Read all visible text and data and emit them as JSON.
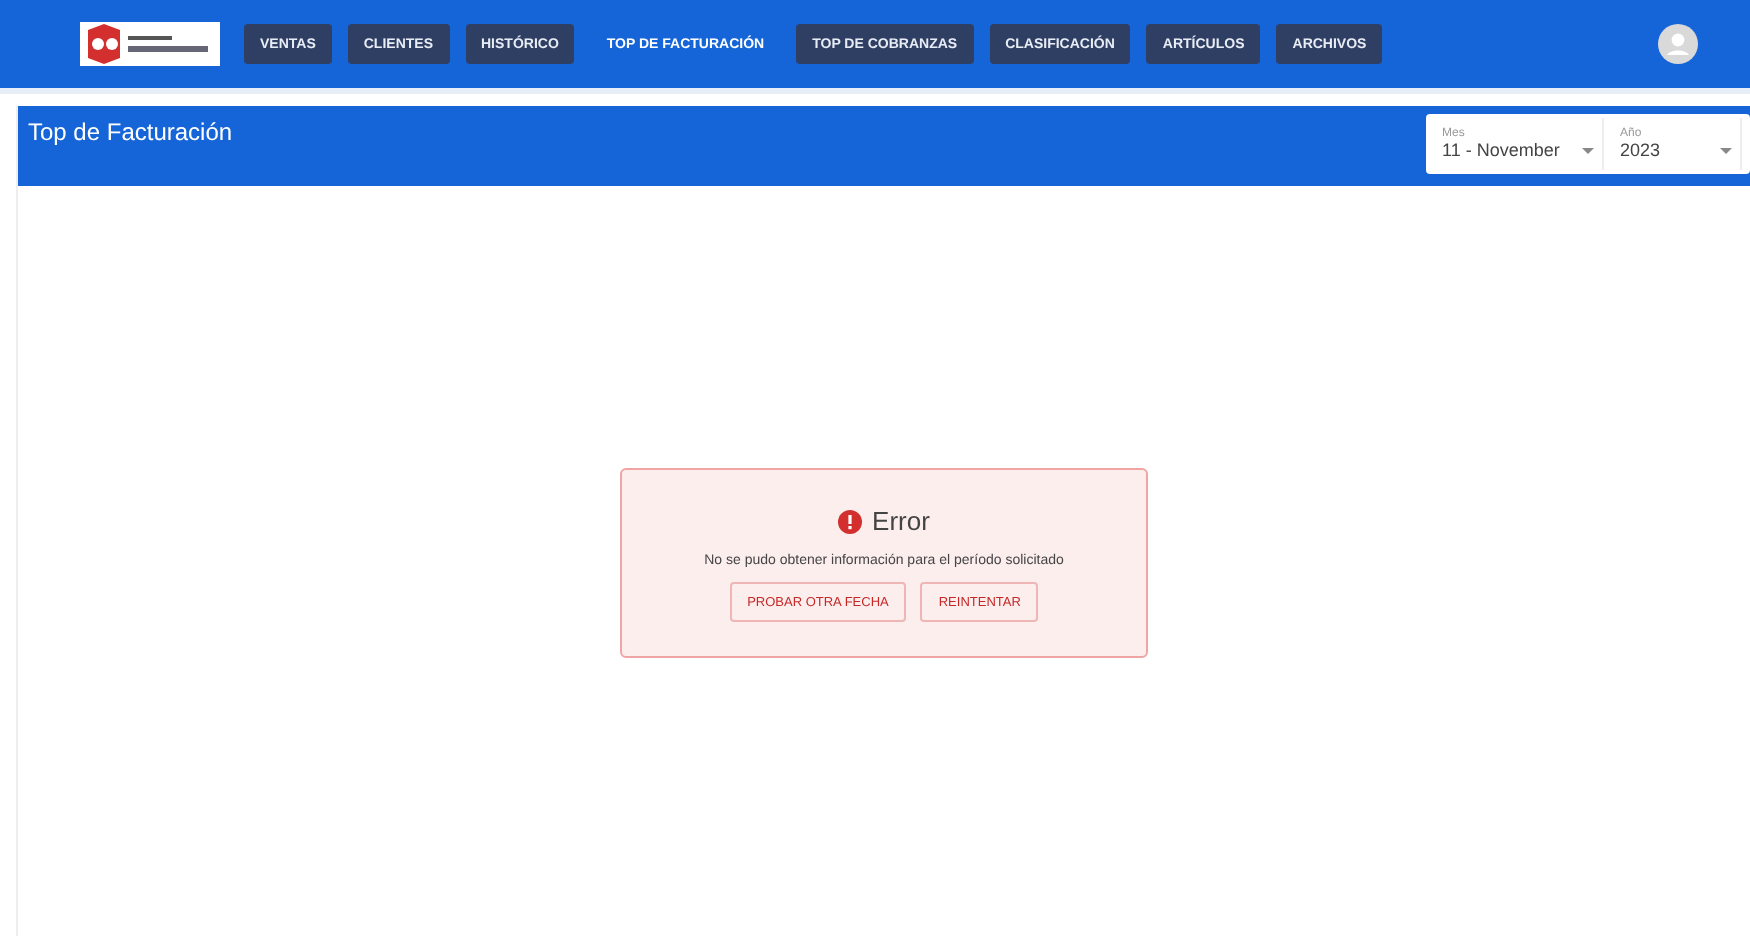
{
  "nav": {
    "items": [
      {
        "label": "VENTAS",
        "selected": false
      },
      {
        "label": "CLIENTES",
        "selected": false
      },
      {
        "label": "HISTÓRICO",
        "selected": false
      },
      {
        "label": "TOP DE FACTURACIÓN",
        "selected": true
      },
      {
        "label": "TOP DE COBRANZAS",
        "selected": false
      },
      {
        "label": "CLASIFICACIÓN",
        "selected": false
      },
      {
        "label": "ARTÍCULOS",
        "selected": false
      },
      {
        "label": "ARCHIVOS",
        "selected": false
      }
    ]
  },
  "header": {
    "title": "Top de Facturación",
    "filters": [
      {
        "label": "Mes",
        "value": "11 - November"
      },
      {
        "label": "Año",
        "value": "2023"
      }
    ]
  },
  "error": {
    "title": "Error",
    "message": "No se pudo obtener información para el período solicitado",
    "buttons": [
      "PROBAR OTRA FECHA",
      "REINTENTAR"
    ]
  }
}
